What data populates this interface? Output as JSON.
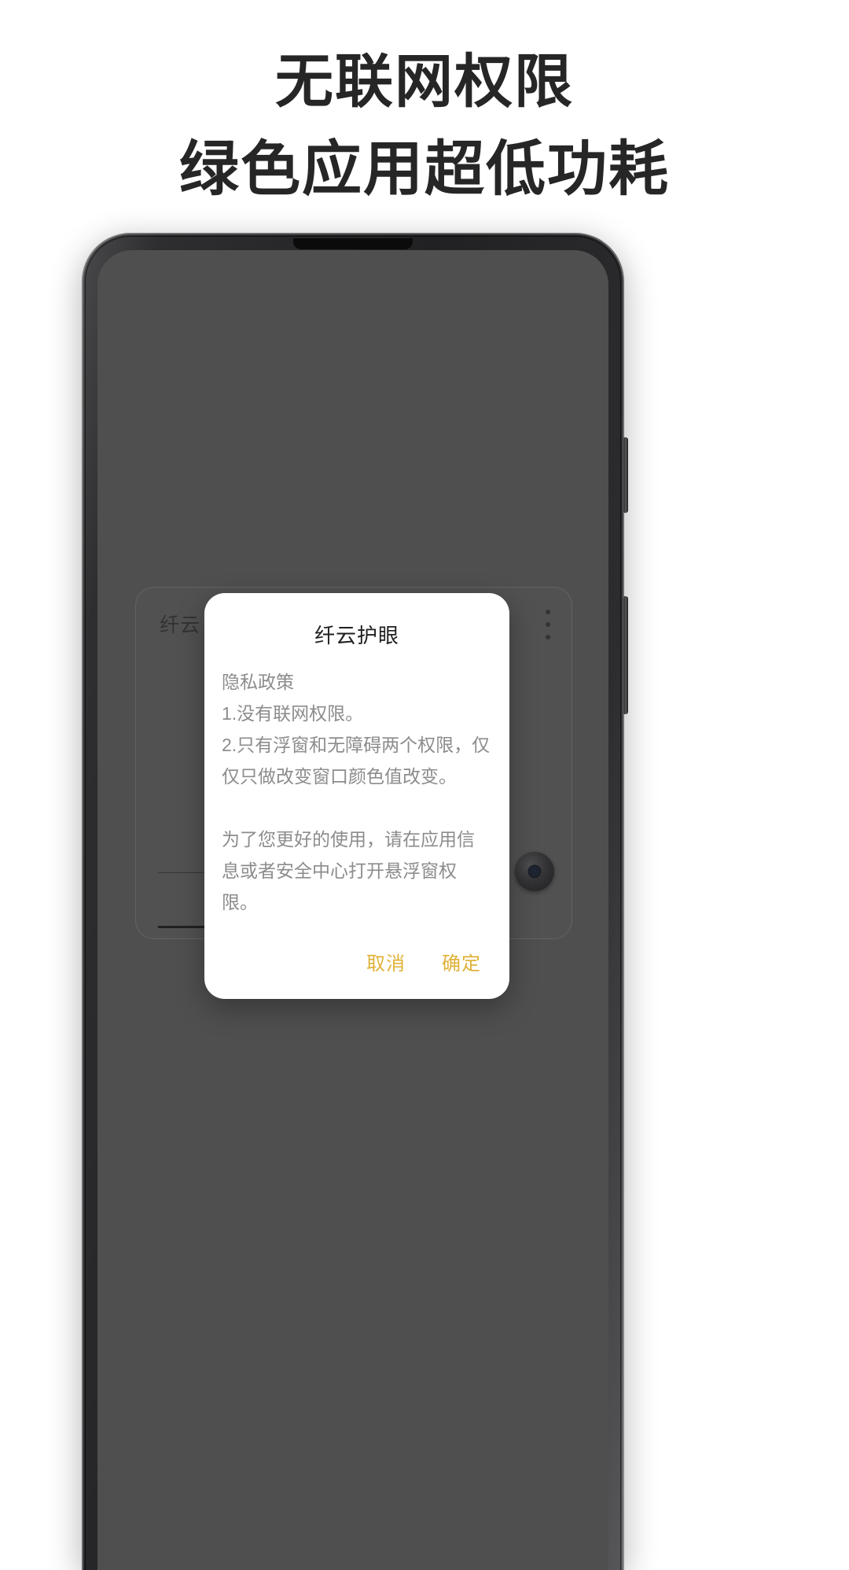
{
  "headline": {
    "line1": "无联网权限",
    "line2": "绿色应用超低功耗"
  },
  "colors": {
    "accent": "#e0b236",
    "headline_text": "#262626",
    "dialog_body_text": "#8c8c8c",
    "screen_background": "#6b6b6b"
  },
  "phone": {
    "app_card": {
      "title": "纤云",
      "menu_icon": "kebab-menu-icon",
      "toggle_icon": "toggle-knob-icon"
    }
  },
  "dialog": {
    "title": "纤云护眼",
    "body": "隐私政策\n1.没有联网权限。\n2.只有浮窗和无障碍两个权限，仅仅只做改变窗口颜色值改变。\n\n为了您更好的使用，请在应用信息或者安全中心打开悬浮窗权限。",
    "cancel_label": "取消",
    "confirm_label": "确定"
  }
}
